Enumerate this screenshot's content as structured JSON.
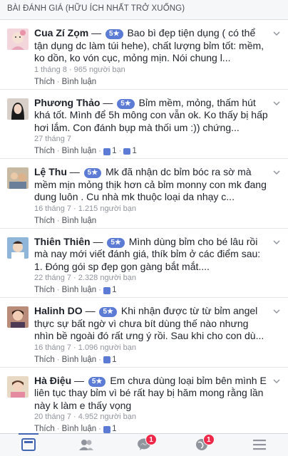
{
  "header": {
    "title": "BÀI ĐÁNH GIÁ (HỮU ÍCH NHẤT TRỞ XUỐNG)"
  },
  "reviews": [
    {
      "name": "Cua Zí Zọm",
      "rating": "5★",
      "text": "Bao bì đẹp tiện dụng ( có thể tận dụng dc làm túi hehe), chất lượng bỉm tốt: mềm, ko dồn, ko vón cục, mỏng mịn. Nói chung l...",
      "meta": "1 tháng 8 · 965 người bạn",
      "like": "Thích",
      "comment": "Bình luận",
      "likes": "",
      "comments": ""
    },
    {
      "name": "Phương Thảo",
      "rating": "5★",
      "text": "Bỉm mềm, mỏng, thấm hút khá tốt. Mình để 5h mông con vẫn ok. Ko thấy bị hấp hơi lắm. Con đánh bụp mà thối um :)) chứng...",
      "meta": "27 tháng 7",
      "like": "Thích",
      "comment": "Bình luận",
      "likes": "1",
      "comments": "1"
    },
    {
      "name": "Lệ Thu",
      "rating": "5★",
      "text": "Mk đã nhận dc bỉm bóc ra sờ mà mềm mịn mỏng thịk hơn cả bỉm monny con mk đang dung luôn . Cu nhà mk thuộc loại da nhạy c...",
      "meta": "16 tháng 7 · 1.215 người bạn",
      "like": "Thích",
      "comment": "Bình luận",
      "likes": "",
      "comments": ""
    },
    {
      "name": "Thiên Thiên",
      "rating": "5★",
      "text": "Mình dùng bỉm cho bé lâu rồi mà nay mới viết đánh giá, thík bỉm ở các điểm sau: 1. Đóng gói sp đẹp gọn gàng bắt mắt....",
      "meta": "22 tháng 7 · 2.328 người bạn",
      "like": "Thích",
      "comment": "Bình luận",
      "likes": "1",
      "comments": ""
    },
    {
      "name": "Halinh DO",
      "rating": "5★",
      "text": "Khi nhận được từ từ bỉm angel thực sự bất ngờ vì chưa bít dùng thế nào nhưng nhìn bề ngoài đó rất ưng ý rồi. Sau khi cho con dù...",
      "meta": "16 tháng 7 · 1.096 người bạn",
      "like": "Thích",
      "comment": "Bình luận",
      "likes": "1",
      "comments": ""
    },
    {
      "name": "Hà Điệu",
      "rating": "5★",
      "text": "Em chưa dùng loại bỉm bên mình E liên tục thay bỉm vì bé rất hay bị hăm mong rằng lần này k làm e thấy vọng",
      "meta": "20 tháng 7 · 4.952 người bạn",
      "like": "Thích",
      "comment": "Bình luận",
      "likes": "1",
      "comments": ""
    }
  ],
  "tabbar": {
    "items": [
      {
        "icon": "news-feed-icon",
        "badge": "",
        "active": true
      },
      {
        "icon": "friends-icon",
        "badge": "",
        "active": false
      },
      {
        "icon": "messenger-icon",
        "badge": "1",
        "active": false
      },
      {
        "icon": "notifications-globe-icon",
        "badge": "1",
        "active": false
      },
      {
        "icon": "menu-icon",
        "badge": "",
        "active": false
      }
    ]
  },
  "colors": {
    "accent": "#5b7bd5",
    "badge": "#f02849",
    "meta": "#90949c"
  }
}
